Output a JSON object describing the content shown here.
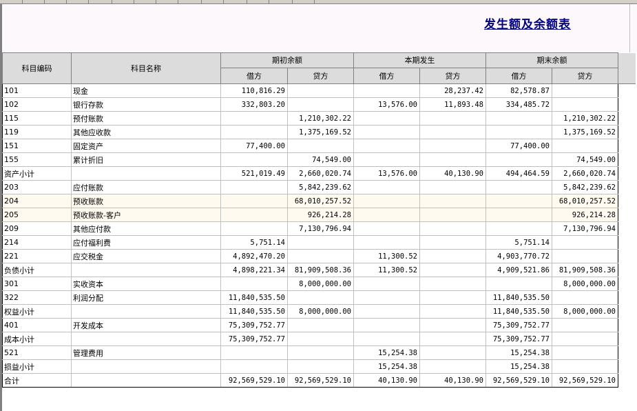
{
  "report": {
    "title": "发生额及余额表"
  },
  "columns": {
    "code": "科目编码",
    "name": "科目名称",
    "groups": [
      "期初余额",
      "本期发生",
      "期末余额"
    ],
    "debit": "借方",
    "credit": "贷方"
  },
  "rows": [
    {
      "code": "101",
      "name": "现金",
      "v": [
        "110,816.29",
        "",
        "",
        "28,237.42",
        "82,578.87",
        ""
      ]
    },
    {
      "code": "102",
      "name": "银行存款",
      "v": [
        "332,803.20",
        "",
        "13,576.00",
        "11,893.48",
        "334,485.72",
        ""
      ]
    },
    {
      "code": "115",
      "name": "预付账款",
      "v": [
        "",
        "1,210,302.22",
        "",
        "",
        "",
        "1,210,302.22"
      ]
    },
    {
      "code": "119",
      "name": "其他应收款",
      "v": [
        "",
        "1,375,169.52",
        "",
        "",
        "",
        "1,375,169.52"
      ]
    },
    {
      "code": "151",
      "name": "固定资产",
      "v": [
        "77,400.00",
        "",
        "",
        "",
        "77,400.00",
        ""
      ]
    },
    {
      "code": "155",
      "name": "累计折旧",
      "v": [
        "",
        "74,549.00",
        "",
        "",
        "",
        "74,549.00"
      ]
    },
    {
      "code": "资产小计",
      "name": "",
      "v": [
        "521,019.49",
        "2,660,020.74",
        "13,576.00",
        "40,130.90",
        "494,464.59",
        "2,660,020.74"
      ]
    },
    {
      "code": "203",
      "name": "应付账款",
      "v": [
        "",
        "5,842,239.62",
        "",
        "",
        "",
        "5,842,239.62"
      ]
    },
    {
      "code": "204",
      "name": "预收账款",
      "highlight": true,
      "v": [
        "",
        "68,010,257.52",
        "",
        "",
        "",
        "68,010,257.52"
      ]
    },
    {
      "code": "205",
      "name": "预收账款-客户",
      "highlight": true,
      "v": [
        "",
        "926,214.28",
        "",
        "",
        "",
        "926,214.28"
      ]
    },
    {
      "code": "209",
      "name": "其他应付款",
      "v": [
        "",
        "7,130,796.94",
        "",
        "",
        "",
        "7,130,796.94"
      ]
    },
    {
      "code": "214",
      "name": "应付福利费",
      "v": [
        "5,751.14",
        "",
        "",
        "",
        "5,751.14",
        ""
      ]
    },
    {
      "code": "221",
      "name": "应交税金",
      "v": [
        "4,892,470.20",
        "",
        "11,300.52",
        "",
        "4,903,770.72",
        ""
      ]
    },
    {
      "code": "负债小计",
      "name": "",
      "v": [
        "4,898,221.34",
        "81,909,508.36",
        "11,300.52",
        "",
        "4,909,521.86",
        "81,909,508.36"
      ]
    },
    {
      "code": "301",
      "name": "实收资本",
      "v": [
        "",
        "8,000,000.00",
        "",
        "",
        "",
        "8,000,000.00"
      ]
    },
    {
      "code": "322",
      "name": "利润分配",
      "v": [
        "11,840,535.50",
        "",
        "",
        "",
        "11,840,535.50",
        ""
      ]
    },
    {
      "code": "权益小计",
      "name": "",
      "v": [
        "11,840,535.50",
        "8,000,000.00",
        "",
        "",
        "11,840,535.50",
        "8,000,000.00"
      ]
    },
    {
      "code": "401",
      "name": "开发成本",
      "v": [
        "75,309,752.77",
        "",
        "",
        "",
        "75,309,752.77",
        ""
      ]
    },
    {
      "code": "成本小计",
      "name": "",
      "v": [
        "75,309,752.77",
        "",
        "",
        "",
        "75,309,752.77",
        ""
      ]
    },
    {
      "code": "521",
      "name": "管理费用",
      "v": [
        "",
        "",
        "15,254.38",
        "",
        "15,254.38",
        ""
      ]
    },
    {
      "code": "损益小计",
      "name": "",
      "v": [
        "",
        "",
        "15,254.38",
        "",
        "15,254.38",
        ""
      ]
    },
    {
      "code": "合计",
      "name": "",
      "v": [
        "92,569,529.10",
        "92,569,529.10",
        "40,130.90",
        "40,130.90",
        "92,569,529.10",
        "92,569,529.10"
      ]
    }
  ]
}
